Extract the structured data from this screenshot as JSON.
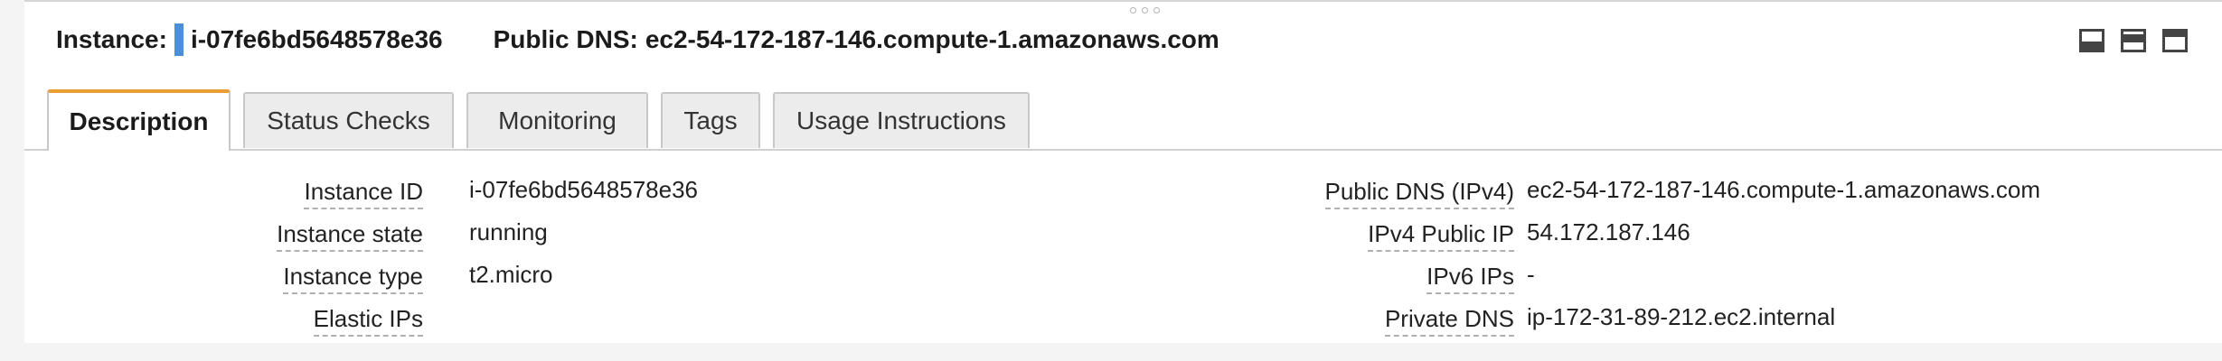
{
  "header": {
    "instance_label": "Instance:",
    "instance_id": "i-07fe6bd5648578e36",
    "dns_label": "Public DNS:",
    "dns_value": "ec2-54-172-187-146.compute-1.amazonaws.com"
  },
  "tabs": [
    {
      "label": "Description"
    },
    {
      "label": "Status Checks"
    },
    {
      "label": "Monitoring"
    },
    {
      "label": "Tags"
    },
    {
      "label": "Usage Instructions"
    }
  ],
  "details_left": [
    {
      "label": "Instance ID",
      "value": "i-07fe6bd5648578e36"
    },
    {
      "label": "Instance state",
      "value": "running"
    },
    {
      "label": "Instance type",
      "value": "t2.micro"
    },
    {
      "label": "Elastic IPs",
      "value": ""
    }
  ],
  "details_right": [
    {
      "label": "Public DNS (IPv4)",
      "value": "ec2-54-172-187-146.compute-1.amazonaws.com"
    },
    {
      "label": "IPv4 Public IP",
      "value": "54.172.187.146"
    },
    {
      "label": "IPv6 IPs",
      "value": "-"
    },
    {
      "label": "Private DNS",
      "value": "ip-172-31-89-212.ec2.internal"
    }
  ],
  "icons": [
    "drag-handle-icon",
    "layout-bottom-icon",
    "layout-split-icon",
    "layout-top-icon"
  ],
  "colors": {
    "active_tab_accent": "#ec9e36",
    "instance_marker": "#4a90d9"
  }
}
